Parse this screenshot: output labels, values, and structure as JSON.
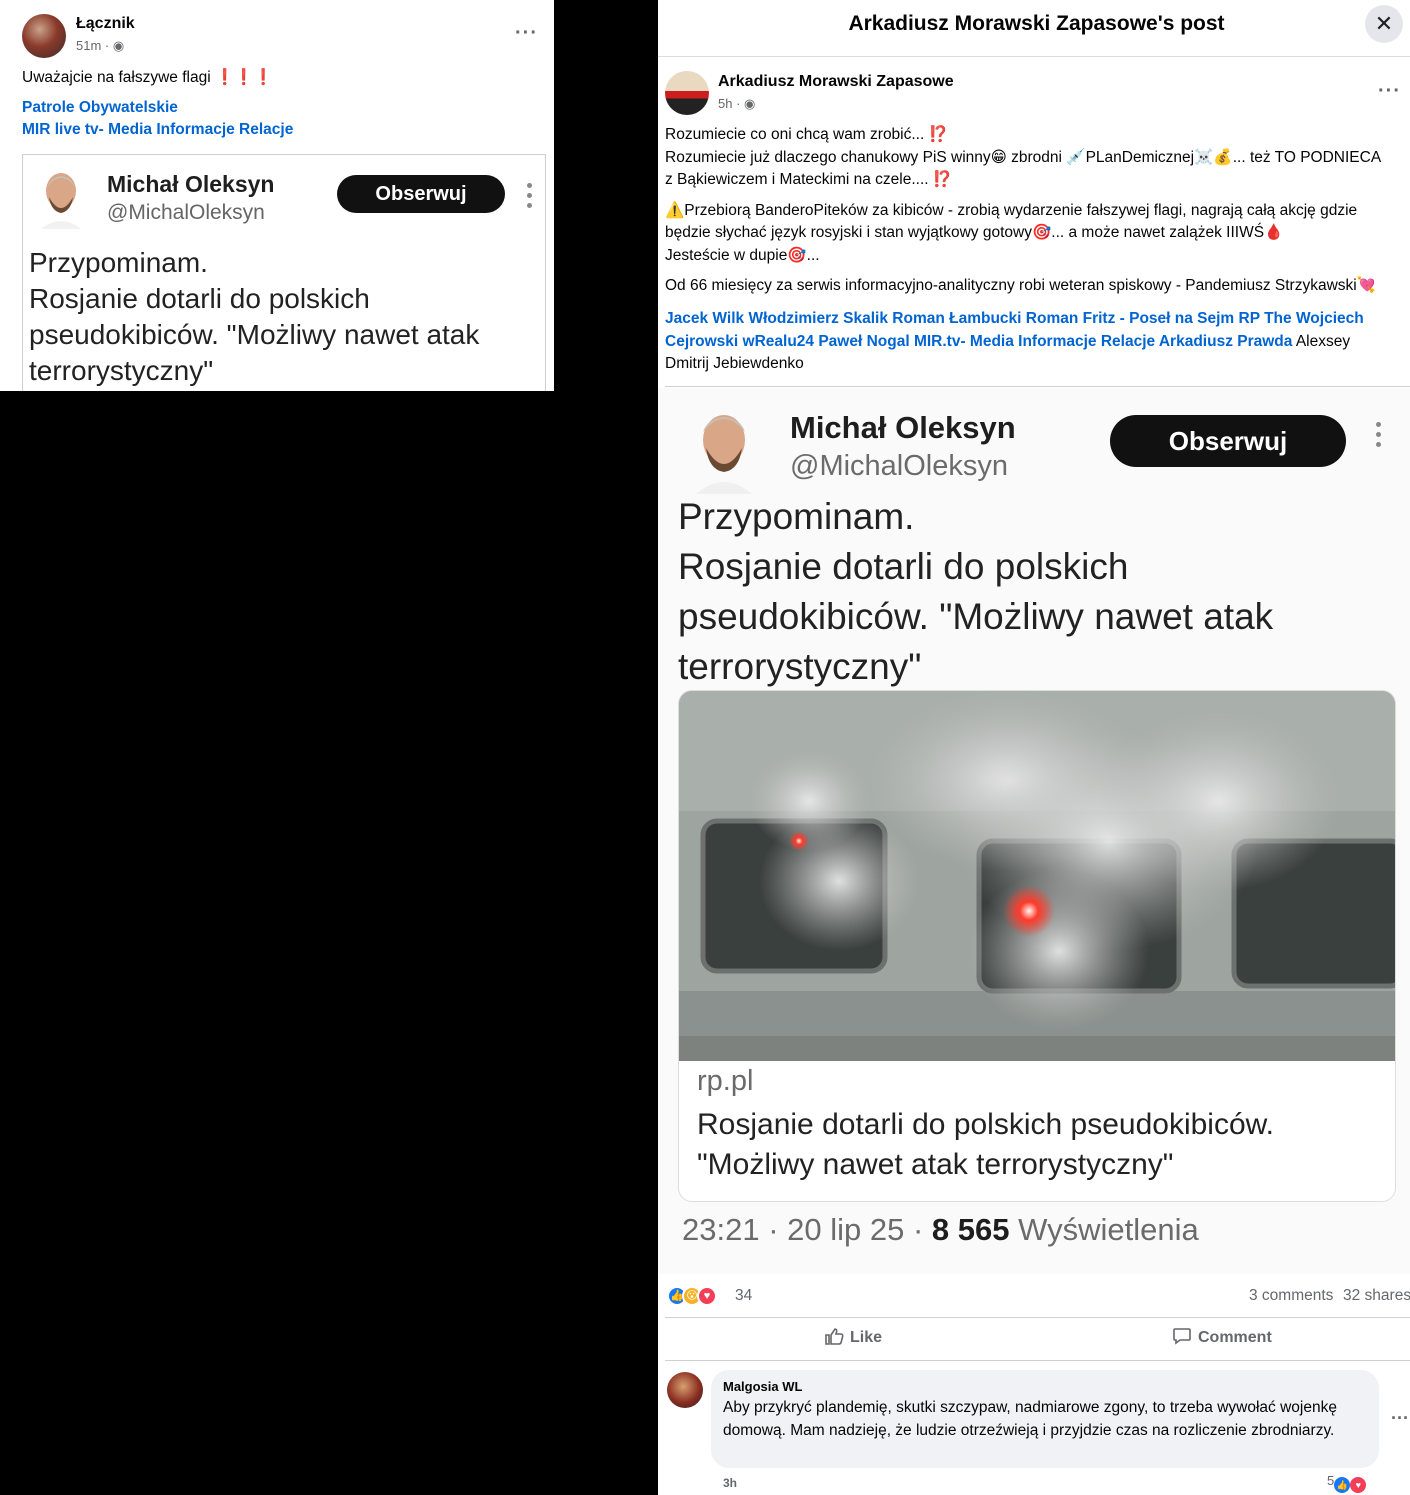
{
  "left_post": {
    "author": "Łącznik",
    "time": "51m",
    "text": "Uważajcie na fałszywe flagi",
    "exclamations": "❗❗❗",
    "tags": [
      "Patrole Obywatelskie",
      "MIR live tv- Media Informacje Relacje"
    ],
    "tweet": {
      "name": "Michał Oleksyn",
      "handle": "@MichalOleksyn",
      "follow_label": "Obserwuj",
      "text_lines": [
        "Przypominam.",
        "Rosjanie dotarli do polskich",
        "pseudokibiców. \"Możliwy nawet atak",
        "terrorystyczny\""
      ]
    }
  },
  "right_post": {
    "header_title": "Arkadiusz Morawski Zapasowe's post",
    "close_icon": "close-icon",
    "author": "Arkadiusz Morawski Zapasowe",
    "time": "5h",
    "body": {
      "line1": "Rozumiecie co oni chcą wam zrobić... ⁉️",
      "line2": "Rozumiecie już dlaczego chanukowy PiS winny😁 zbrodni 💉PLanDemicznej☠️💰... też TO PODNIECA",
      "line3": "z Bąkiewiczem  i Mateckimi na czele.... ⁉️",
      "line4": "⚠️Przebiorą BanderoPiteków za kibiców - zrobią wydarzenie fałszywej flagi, nagrają całą akcję gdzie",
      "line5": "będzie słychać język rosyjski i stan wyjątkowy gotowy🎯... a może nawet zalążek IIIWŚ🩸",
      "line6": "Jesteście w dupie🎯...",
      "line7": "Od 66 miesięcy za serwis informacyjno-analityczny robi weteran spiskowy - Pandemiusz Strzykawski💘"
    },
    "tags_line1": "Jacek Wilk Włodzimierz Skalik Roman Łambucki Roman Fritz - Poseł na Sejm RP The Wojciech",
    "tags_line2": "Cejrowski wRealu24 Paweł Nogal MIR.tv- Media Informacje Relacje Arkadiusz Prawda",
    "tags_plain": "Alexsey",
    "tags_line3": "Dmitrij Jebiewdenko",
    "tweet": {
      "name": "Michał Oleksyn",
      "handle": "@MichalOleksyn",
      "follow_label": "Obserwuj",
      "text_lines": [
        "Przypominam.",
        "Rosjanie dotarli do polskich",
        "pseudokibiców. \"Możliwy nawet atak",
        "terrorystyczny\""
      ],
      "card_domain": "rp.pl",
      "card_title_lines": [
        "Rosjanie dotarli do polskich pseudokibiców.",
        "\"Możliwy nawet atak terrorystyczny\""
      ],
      "meta_time": "23:21 · 20 lip 25 ·",
      "meta_views": "8 565",
      "meta_views_label": "Wyświetlenia"
    },
    "reactions": {
      "count": "34",
      "comments": "3 comments",
      "shares": "32 shares"
    },
    "actions": {
      "like": "Like",
      "comment": "Comment"
    },
    "comment": {
      "author": "Malgosia WL",
      "text": "Aby przykryć plandemię, skutki szczypaw, nadmiarowe zgony, to trzeba wywołać wojenkę domową. Mam nadzieję, że ludzie otrzeźwieją i przyjdzie czas na rozliczenie zbrodniarzy.",
      "time": "3h",
      "reaction_count": "5"
    }
  }
}
